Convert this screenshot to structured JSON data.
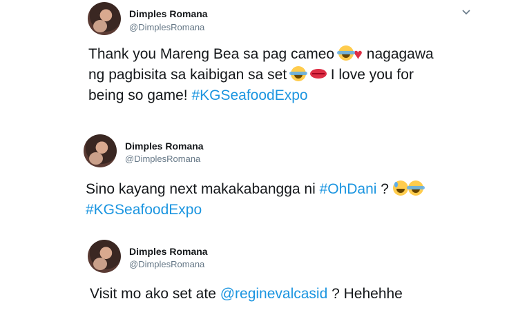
{
  "tweets": [
    {
      "name": "Dimples Romana",
      "handle": "@DimplesRomana",
      "line1": "Thank you Mareng Bea sa pag cameo ",
      "line1b": " nagagawa",
      "line2": "ng pagbisita sa kaibigan sa set ",
      "line2b": " I love you for",
      "line3": "being so game! ",
      "hashtag": "#KGSeafoodExpo"
    },
    {
      "name": "Dimples Romana",
      "handle": "@DimplesRomana",
      "line1": "Sino kayang next makakabangga ni ",
      "hashtag1": "#OhDani",
      "line1b": " ? ",
      "hashtag2": "#KGSeafoodExpo"
    },
    {
      "name": "Dimples Romana",
      "handle": "@DimplesRomana",
      "line1": "Visit mo ako set ate ",
      "mention": "@reginevalcasid",
      "line1b": " ? Hehehhe"
    }
  ],
  "icons": {
    "avatar": "profile-photo",
    "menu": "chevron-down-icon"
  }
}
